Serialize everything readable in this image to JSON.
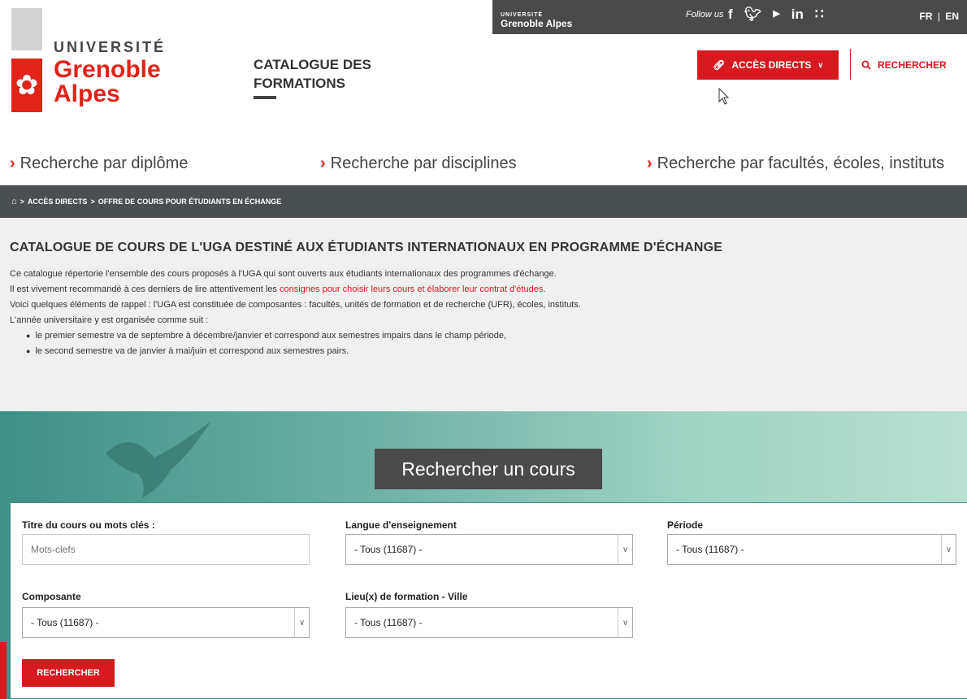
{
  "topbar": {
    "uga_small": "UNIVERSITÉ",
    "uga_name": "Grenoble Alpes",
    "follow_label": "Follow us",
    "social_icons": [
      "facebook-icon",
      "twitter-icon",
      "youtube-icon",
      "linkedin-icon",
      "rss-icon"
    ],
    "lang_fr": "FR",
    "lang_sep": "|",
    "lang_en": "EN"
  },
  "logo": {
    "line1": "UNIVERSITÉ",
    "line2": "Grenoble",
    "line3": "Alpes"
  },
  "header": {
    "catalogue_line1": "CATALOGUE DES",
    "catalogue_line2": "FORMATIONS",
    "acces_directs": "ACCÈS DIRECTS",
    "rechercher": "RECHERCHER"
  },
  "search_by": [
    "Recherche par diplôme",
    "Recherche par disciplines",
    "Recherche par facultés, écoles, instituts"
  ],
  "breadcrumb": {
    "sep": ">",
    "item1": "ACCÈS DIRECTS",
    "item2": "OFFRE DE COURS POUR ÉTUDIANTS EN ÉCHANGE"
  },
  "intro": {
    "title": "CATALOGUE DE COURS DE L'UGA DESTINÉ AUX ÉTUDIANTS INTERNATIONAUX EN PROGRAMME D'ÉCHANGE",
    "p1": "Ce catalogue répertorie l'ensemble des cours proposés à l'UGA qui sont ouverts aux étudiants internationaux des programmes d'échange.",
    "p2_before": "Il est vivement recommandé à ces derniers de lire attentivement les ",
    "p2_link": "consignes pour choisir leurs cours et élaborer leur contrat d'études",
    "p2_after": ".",
    "p3": "Voici quelques éléments de rappel : l'UGA est constituée de composantes : facultés, unités de formation et de recherche (UFR), écoles, instituts.",
    "p4": "L'année universitaire y est organisée comme suit :",
    "bullets": [
      "le premier semestre va de septembre à décembre/janvier et correspond aux semestres impairs dans le champ période,",
      "le second semestre va de janvier à mai/juin et correspond aux semestres pairs."
    ]
  },
  "search_form": {
    "title": "Rechercher un cours",
    "keywords_label": "Titre du cours ou mots clés :",
    "keywords_placeholder": "Mots-clefs",
    "langue_label": "Langue d'enseignement",
    "langue_value": "- Tous (11687) -",
    "periode_label": "Période",
    "periode_value": "- Tous (11687) -",
    "composante_label": "Composante",
    "composante_value": "- Tous (11687) -",
    "lieu_label": "Lieu(x) de formation - Ville",
    "lieu_value": "- Tous (11687) -",
    "submit_label": "RECHERCHER"
  },
  "colors": {
    "brand_red": "#d71920",
    "dark_bar": "#4a4a4a",
    "teal": "#6fb3a6"
  }
}
